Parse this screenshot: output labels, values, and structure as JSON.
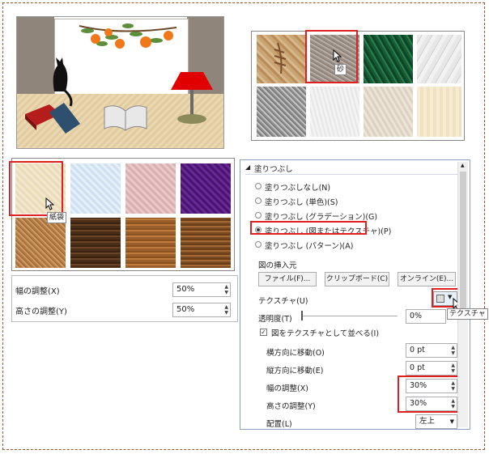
{
  "tooltips": {
    "sand": "砂",
    "papyrus": "紙袋",
    "texture_button": "テクスチャ"
  },
  "size_panel": {
    "width_label": "幅の調整(X)",
    "width_value": "50%",
    "height_label": "高さの調整(Y)",
    "height_value": "50%"
  },
  "pane": {
    "section_title": "塗りつぶし",
    "fill_options": [
      "塗りつぶしなし(N)",
      "塗りつぶし (単色)(S)",
      "塗りつぶし (グラデーション)(G)",
      "塗りつぶし (図またはテクスチャ)(P)",
      "塗りつぶし (パターン)(A)"
    ],
    "selected_fill": "塗りつぶし (図またはテクスチャ)(P)",
    "insert_from_label": "図の挿入元",
    "file_button": "ファイル(F)...",
    "clipboard_button": "クリップボード(C)",
    "online_button": "オンライン(E)...",
    "texture_label": "テクスチャ(U)",
    "transparency_label": "透明度(T)",
    "transparency_value": "0%",
    "tile_checkbox_label": "図をテクスチャとして並べる(I)",
    "tile_checked": true,
    "offset_x_label": "横方向に移動(O)",
    "offset_x_value": "0 pt",
    "offset_y_label": "縦方向に移動(E)",
    "offset_y_value": "0 pt",
    "scale_x_label": "幅の調整(X)",
    "scale_x_value": "30%",
    "scale_y_label": "高さの調整(Y)",
    "scale_y_value": "30%",
    "alignment_label": "配置(L)",
    "alignment_value": "左上"
  },
  "colors": {
    "highlight": "#e02020",
    "pane_border": "#8aa0bd",
    "frame": "#a0522d"
  }
}
